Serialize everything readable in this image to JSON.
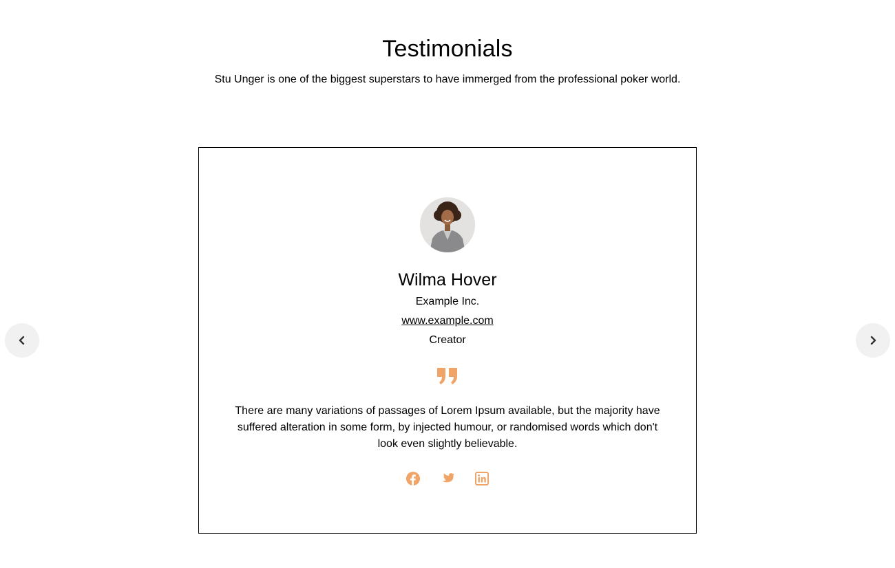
{
  "section": {
    "title": "Testimonials",
    "subtitle": "Stu Unger is one of the biggest superstars to have immerged from the professional poker world."
  },
  "testimonial": {
    "name": "Wilma Hover",
    "company": "Example Inc.",
    "website": "www.example.com",
    "role": "Creator",
    "quote": "There are many variations of passages of Lorem Ipsum available, but the majority have suffered alteration in some form, by injected humour, or randomised words which don't look even slightly believable.",
    "socials": [
      "facebook-icon",
      "twitter-icon",
      "linkedin-icon"
    ]
  },
  "colors": {
    "accent": "#f0a468",
    "nav_bg": "#f1f1f1",
    "nav_icon": "#333333"
  },
  "navigation": {
    "prev_icon": "chevron-left-icon",
    "next_icon": "chevron-right-icon"
  }
}
